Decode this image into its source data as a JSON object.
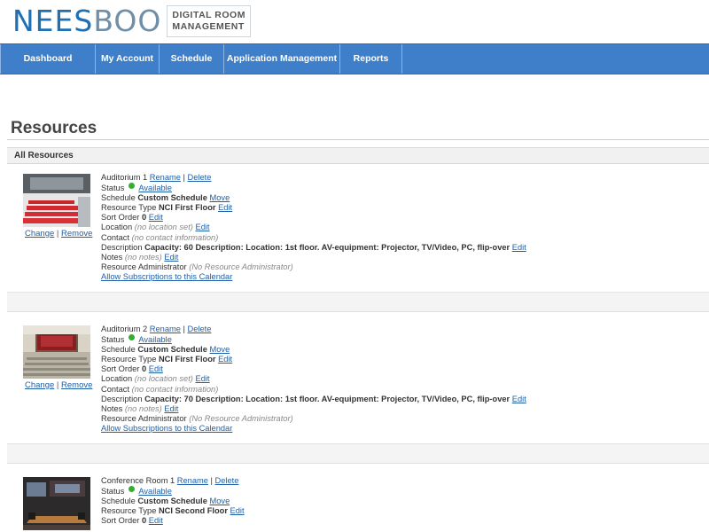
{
  "brand": {
    "logo_part1": "NEES",
    "logo_part2": "BOO",
    "tagline_line1": "DIGITAL ROOM",
    "tagline_line2": "MANAGEMENT",
    "colors": {
      "navbar": "#3f7fc9",
      "link": "#1f5fa8",
      "status_available": "#2fb12f"
    }
  },
  "nav": [
    {
      "label": "Dashboard"
    },
    {
      "label": "My Account"
    },
    {
      "label": "Schedule"
    },
    {
      "label": "Application Management"
    },
    {
      "label": "Reports"
    }
  ],
  "page": {
    "title": "Resources",
    "section": "All Resources"
  },
  "resources": [
    {
      "name": "Auditorium 1",
      "rename": "Rename",
      "delete": "Delete",
      "thumb_icon": "auditorium-red-seats-photo",
      "change": "Change",
      "remove": "Remove",
      "status_label": "Status",
      "status_value": "Available",
      "schedule_label": "Schedule",
      "schedule_value": "Custom Schedule",
      "schedule_action": "Move",
      "type_label": "Resource Type",
      "type_value": "NCI First Floor",
      "type_action": "Edit",
      "sort_label": "Sort Order",
      "sort_value": "0",
      "sort_action": "Edit",
      "location_label": "Location",
      "location_value": "(no location set)",
      "location_action": "Edit",
      "contact_label": "Contact",
      "contact_value": "(no contact information)",
      "description_label": "Description",
      "description_value": "Capacity: 60 Description: Location: 1st floor. AV-equipment: Projector, TV/Video, PC, flip-over",
      "description_action": "Edit",
      "notes_label": "Notes",
      "notes_value": "(no notes)",
      "notes_action": "Edit",
      "admin_label": "Resource Administrator",
      "admin_value": "(No Resource Administrator)",
      "subscribe": "Allow Subscriptions to this Calendar"
    },
    {
      "name": "Auditorium 2",
      "rename": "Rename",
      "delete": "Delete",
      "thumb_icon": "auditorium-stage-photo",
      "change": "Change",
      "remove": "Remove",
      "status_label": "Status",
      "status_value": "Available",
      "schedule_label": "Schedule",
      "schedule_value": "Custom Schedule",
      "schedule_action": "Move",
      "type_label": "Resource Type",
      "type_value": "NCI First Floor",
      "type_action": "Edit",
      "sort_label": "Sort Order",
      "sort_value": "0",
      "sort_action": "Edit",
      "location_label": "Location",
      "location_value": "(no location set)",
      "location_action": "Edit",
      "contact_label": "Contact",
      "contact_value": "(no contact information)",
      "description_label": "Description",
      "description_value": "Capacity: 70 Description: Location: 1st floor. AV-equipment: Projector, TV/Video, PC, flip-over",
      "description_action": "Edit",
      "notes_label": "Notes",
      "notes_value": "(no notes)",
      "notes_action": "Edit",
      "admin_label": "Resource Administrator",
      "admin_value": "(No Resource Administrator)",
      "subscribe": "Allow Subscriptions to this Calendar"
    },
    {
      "name": "Conference Room 1",
      "rename": "Rename",
      "delete": "Delete",
      "thumb_icon": "conference-room-photo",
      "status_label": "Status",
      "status_value": "Available",
      "schedule_label": "Schedule",
      "schedule_value": "Custom Schedule",
      "schedule_action": "Move",
      "type_label": "Resource Type",
      "type_value": "NCI Second Floor",
      "type_action": "Edit",
      "sort_label": "Sort Order",
      "sort_value": "0",
      "sort_action": "Edit"
    }
  ]
}
